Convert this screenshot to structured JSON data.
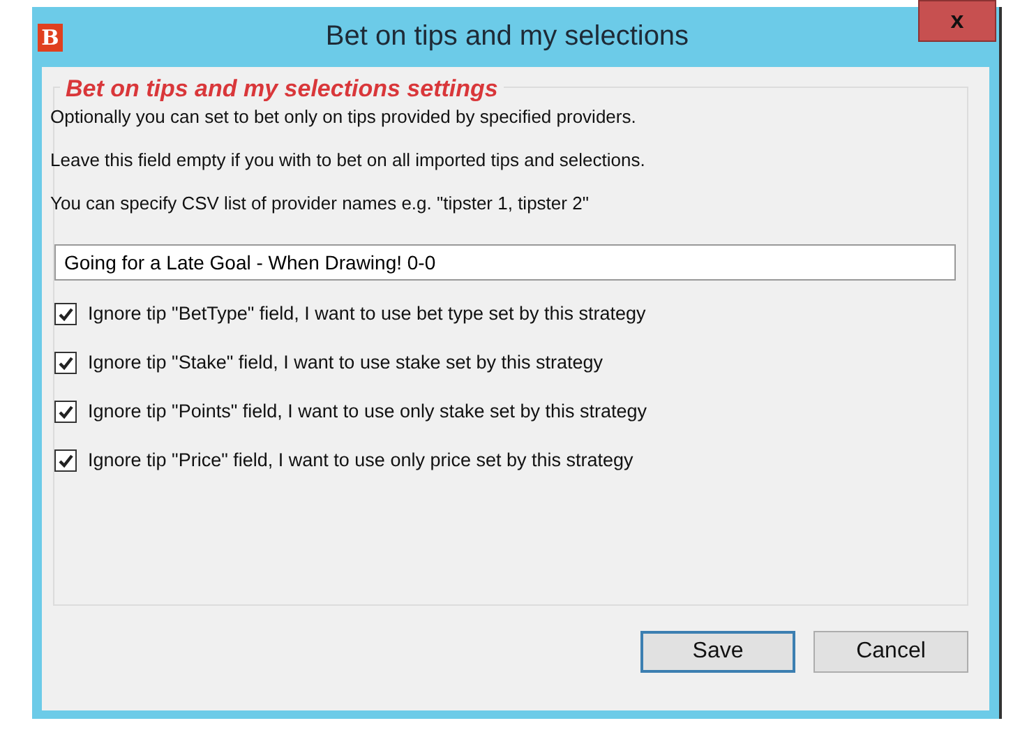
{
  "window": {
    "logo": "B",
    "title": "Bet on tips and my selections",
    "close": "x"
  },
  "group": {
    "title": "Bet on tips and my selections settings",
    "paragraphs": [
      "Optionally you can set to bet only on tips provided by specified providers.",
      "Leave this field empty if you with to bet on all imported tips and selections.",
      "You can specify CSV list of provider names e.g. \"tipster 1, tipster 2\""
    ],
    "providers_field": {
      "value": "Going for a Late Goal - When Drawing! 0-0"
    },
    "options": [
      {
        "label": "Ignore tip \"BetType\" field, I want to use bet type set by this strategy",
        "checked": true
      },
      {
        "label": "Ignore tip \"Stake\" field, I want to use stake set by this strategy",
        "checked": true
      },
      {
        "label": "Ignore tip \"Points\" field, I want to use only stake set by this strategy",
        "checked": true
      },
      {
        "label": "Ignore tip \"Price\" field, I want to use only price set by this strategy",
        "checked": true
      }
    ]
  },
  "buttons": [
    {
      "label": "Save",
      "selected": true
    },
    {
      "label": "Cancel",
      "selected": false
    }
  ]
}
